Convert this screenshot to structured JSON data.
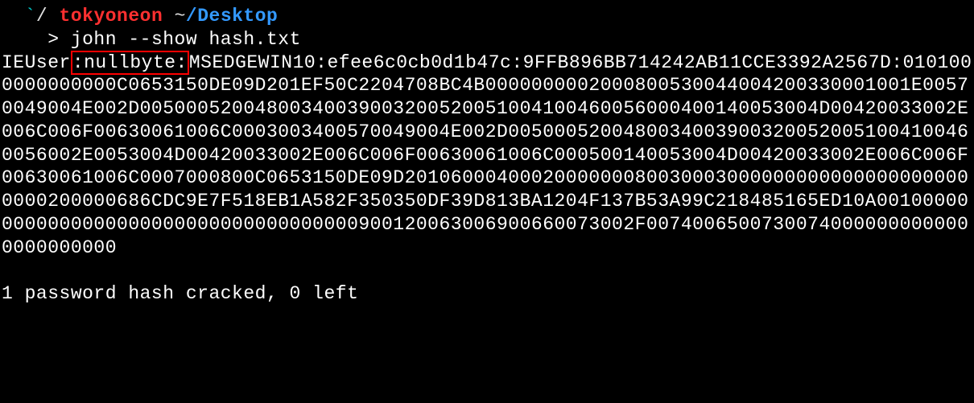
{
  "prompt": {
    "backtick": "`",
    "slash": "/",
    "user": "tokyoneon",
    "tilde": "~",
    "slash2": "/",
    "dir": "Desktop"
  },
  "command": {
    "prefix": "    > ",
    "text": "john --show hash.txt"
  },
  "output": {
    "prefix": "IEUser",
    "highlight": ":nullbyte:",
    "hash": "MSEDGEWIN10:efee6c0cb0d1b47c:9FFB896BB714242AB11CCE3392A2567D:0101000000000000C0653150DE09D201EF50C2204708BC4B0000000002000800530044004200330001001E00570049004E002D00500052004800340039003200520051004100460056000400140053004D00420033002E006C006F00630061006C0003003400570049004E002D00500052004800340039003200520051004100460056002E0053004D00420033002E006C006F00630061006C000500140053004D00420033002E006C006F00630061006C0007000800C0653150DE09D20106000400020000000800300030000000000000000000000000200000686CDC9E7F518EB1A582F350350DF39D813BA1204F137B53A99C218485165ED10A001000000000000000000000000000000000000900120063006900660073002F00740065007300740000000000000000000000"
  },
  "summary": "1 password hash cracked, 0 left"
}
